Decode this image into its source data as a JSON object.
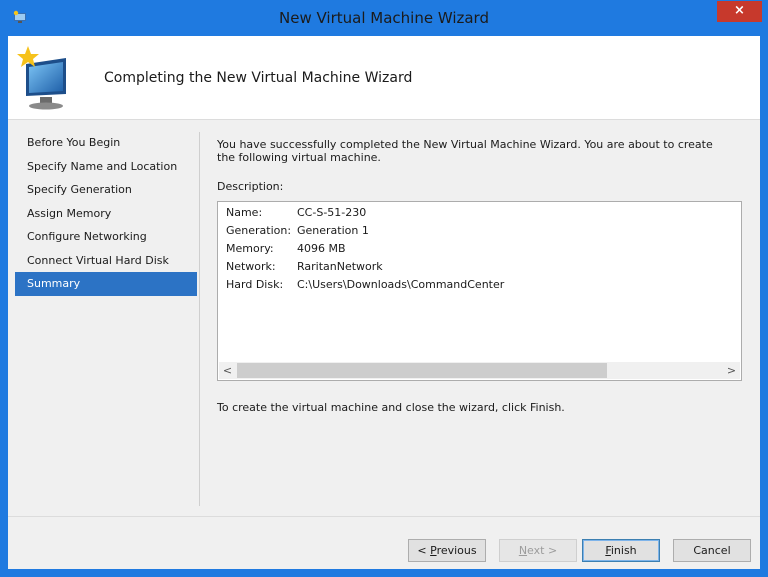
{
  "window": {
    "title": "New Virtual Machine Wizard",
    "close_glyph": "×",
    "accent": "#1f7ae0"
  },
  "header": {
    "title": "Completing the New Virtual Machine Wizard"
  },
  "nav": {
    "items": [
      {
        "label": "Before You Begin",
        "active": false
      },
      {
        "label": "Specify Name and Location",
        "active": false
      },
      {
        "label": "Specify Generation",
        "active": false
      },
      {
        "label": "Assign Memory",
        "active": false
      },
      {
        "label": "Configure Networking",
        "active": false
      },
      {
        "label": "Connect Virtual Hard Disk",
        "active": false
      },
      {
        "label": "Summary",
        "active": true
      }
    ]
  },
  "content": {
    "intro": "You have successfully completed the New Virtual Machine Wizard. You are about to create the following virtual machine.",
    "description_label": "Description:",
    "description": [
      {
        "key": "Name:",
        "value": "CC-S-51-230"
      },
      {
        "key": "Generation:",
        "value": "Generation 1"
      },
      {
        "key": "Memory:",
        "value": "4096 MB"
      },
      {
        "key": "Network:",
        "value": "RaritanNetwork"
      },
      {
        "key": "Hard Disk:",
        "value": "C:\\Users\\Downloads\\CommandCenter"
      }
    ],
    "scroll_left_glyph": "<",
    "scroll_right_glyph": ">",
    "finish_note": "To create the virtual machine and close the wizard, click Finish."
  },
  "buttons": {
    "previous": {
      "prefix": "< ",
      "mnemonic": "P",
      "rest": "revious"
    },
    "next": {
      "mnemonic": "N",
      "rest": "ext >"
    },
    "finish": {
      "mnemonic": "F",
      "rest": "inish"
    },
    "cancel": "Cancel"
  }
}
